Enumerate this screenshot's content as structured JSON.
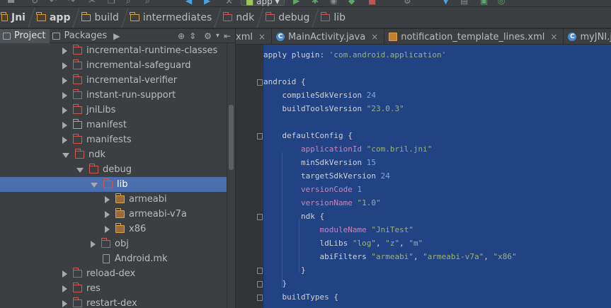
{
  "toolbar": {
    "run_config": "app"
  },
  "breadcrumb": [
    "Jni",
    "app",
    "build",
    "intermediates",
    "ndk",
    "debug",
    "lib"
  ],
  "project_panel": {
    "tabs": [
      "Project",
      "Packages"
    ],
    "tree": [
      {
        "label": "incremental-runtime-classes",
        "depth": 0,
        "expanded": false,
        "kind": "folder-red"
      },
      {
        "label": "incremental-safeguard",
        "depth": 0,
        "expanded": false,
        "kind": "folder-red"
      },
      {
        "label": "incremental-verifier",
        "depth": 0,
        "expanded": false,
        "kind": "folder-red"
      },
      {
        "label": "instant-run-support",
        "depth": 0,
        "expanded": false,
        "kind": "folder-red"
      },
      {
        "label": "jniLibs",
        "depth": 0,
        "expanded": false,
        "kind": "folder-red"
      },
      {
        "label": "manifest",
        "depth": 0,
        "expanded": false,
        "kind": "folder-grey"
      },
      {
        "label": "manifests",
        "depth": 0,
        "expanded": false,
        "kind": "folder-red"
      },
      {
        "label": "ndk",
        "depth": 0,
        "expanded": true,
        "kind": "folder-red"
      },
      {
        "label": "debug",
        "depth": 1,
        "expanded": true,
        "kind": "folder-red"
      },
      {
        "label": "lib",
        "depth": 2,
        "expanded": true,
        "kind": "folder-red",
        "selected": true
      },
      {
        "label": "armeabi",
        "depth": 3,
        "expanded": false,
        "kind": "folder-filled"
      },
      {
        "label": "armeabi-v7a",
        "depth": 3,
        "expanded": false,
        "kind": "folder-filled"
      },
      {
        "label": "x86",
        "depth": 3,
        "expanded": false,
        "kind": "folder-filled"
      },
      {
        "label": "obj",
        "depth": 2,
        "expanded": false,
        "kind": "folder-red"
      },
      {
        "label": "Android.mk",
        "depth": 2,
        "expanded": null,
        "kind": "file"
      },
      {
        "label": "reload-dex",
        "depth": 0,
        "expanded": false,
        "kind": "folder-red"
      },
      {
        "label": "res",
        "depth": 0,
        "expanded": false,
        "kind": "folder-red"
      },
      {
        "label": "restart-dex",
        "depth": 0,
        "expanded": false,
        "kind": "folder-red"
      }
    ]
  },
  "editor": {
    "tabs": [
      {
        "label": "xml",
        "icon": "none"
      },
      {
        "label": "MainActivity.java",
        "icon": "class-icon"
      },
      {
        "label": "notification_template_lines.xml",
        "icon": "xml-icon"
      },
      {
        "label": "myJNI.java",
        "icon": "class-icon"
      }
    ],
    "code_lines": [
      [
        [
          "apply plugin: ",
          "p"
        ],
        [
          "'com.android.application'",
          "s"
        ]
      ],
      [],
      [
        [
          "android {",
          "p"
        ]
      ],
      [
        [
          "    compileSdkVersion ",
          "p"
        ],
        [
          "24",
          "n"
        ]
      ],
      [
        [
          "    buildToolsVersion ",
          "p"
        ],
        [
          "\"23.0.3\"",
          "s"
        ]
      ],
      [],
      [
        [
          "    defaultConfig {",
          "p"
        ]
      ],
      [
        [
          "        ",
          "p"
        ],
        [
          "applicationId",
          "k"
        ],
        [
          " ",
          "p"
        ],
        [
          "\"com.bril.jni\"",
          "s"
        ]
      ],
      [
        [
          "        minSdkVersion ",
          "p"
        ],
        [
          "15",
          "n"
        ]
      ],
      [
        [
          "        targetSdkVersion ",
          "p"
        ],
        [
          "24",
          "n"
        ]
      ],
      [
        [
          "        ",
          "p"
        ],
        [
          "versionCode",
          "k"
        ],
        [
          " ",
          "p"
        ],
        [
          "1",
          "n"
        ]
      ],
      [
        [
          "        ",
          "p"
        ],
        [
          "versionName",
          "k"
        ],
        [
          " ",
          "p"
        ],
        [
          "\"1.0\"",
          "s"
        ]
      ],
      [
        [
          "        ndk {",
          "p"
        ]
      ],
      [
        [
          "            ",
          "p"
        ],
        [
          "moduleName",
          "k"
        ],
        [
          " ",
          "p"
        ],
        [
          "\"JniTest\"",
          "s"
        ]
      ],
      [
        [
          "            ldLibs ",
          "p"
        ],
        [
          "\"log\"",
          "s"
        ],
        [
          ", ",
          "p"
        ],
        [
          "\"z\"",
          "s"
        ],
        [
          ", ",
          "p"
        ],
        [
          "\"m\"",
          "s"
        ]
      ],
      [
        [
          "            abiFilters ",
          "p"
        ],
        [
          "\"armeabi\"",
          "s"
        ],
        [
          ", ",
          "p"
        ],
        [
          "\"armeabi-v7a\"",
          "s"
        ],
        [
          ", ",
          "p"
        ],
        [
          "\"x86\"",
          "s"
        ]
      ],
      [
        [
          "        }",
          "p"
        ]
      ],
      [
        [
          "    }",
          "p"
        ]
      ],
      [
        [
          "    buildTypes {",
          "p"
        ]
      ]
    ]
  },
  "colors": {
    "selection": "#214283",
    "tree_selected": "#4b6eaf",
    "string": "#9ab17d",
    "property": "#c886be",
    "number": "#7aa6da"
  }
}
